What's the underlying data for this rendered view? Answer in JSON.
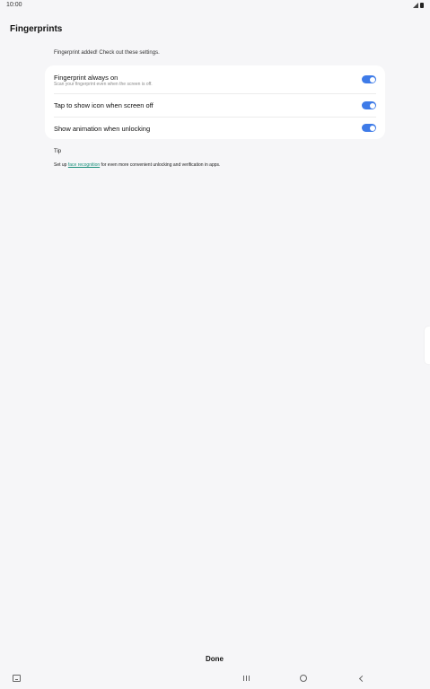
{
  "status_bar": {
    "time": "10:00"
  },
  "header": {
    "title": "Fingerprints"
  },
  "intro": {
    "text": "Fingerprint added! Check out these settings."
  },
  "settings": [
    {
      "title": "Fingerprint always on",
      "summary": "Scan your fingerprint even when the screen is off.",
      "enabled": true
    },
    {
      "title": "Tap to show icon when screen off",
      "enabled": true
    },
    {
      "title": "Show animation when unlocking",
      "enabled": true
    }
  ],
  "tip": {
    "heading": "Tip",
    "prefix": "Set up ",
    "link": "face recognition",
    "suffix": " for even more convenient unlocking and verification in apps."
  },
  "footer": {
    "done_label": "Done"
  },
  "colors": {
    "accent": "#3e7be8",
    "link": "#1a8f7a",
    "background": "#f6f6f8",
    "card": "#ffffff"
  },
  "icons": {
    "signal": "signal-icon",
    "battery": "battery-icon",
    "keyboard": "keyboard-icon",
    "recents": "recents-icon",
    "home": "home-icon",
    "back": "back-icon"
  }
}
